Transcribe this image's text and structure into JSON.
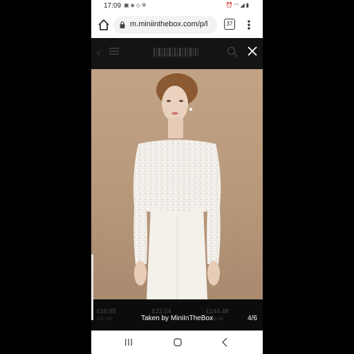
{
  "status_bar": {
    "time": "17:09",
    "left_icons": [
      "gallery-icon",
      "notification-icon",
      "location-icon",
      "settings-icon"
    ],
    "right_icons": [
      "alarm-icon",
      "wifi-icon",
      "signal-icon",
      "battery-icon"
    ]
  },
  "browser": {
    "url": "m.miniinthebox.com/p/l",
    "tab_count": "37"
  },
  "overlay": {
    "caption": "Taken by MiniInTheBox",
    "counter": "4/6",
    "logo_text": "MiniInTheBox.com"
  },
  "prices": [
    {
      "price": "£16.05",
      "old": "£32.06"
    },
    {
      "price": "£22.54",
      "old": "£45.08"
    },
    {
      "price": "£144.48",
      "old": "£288.96"
    }
  ],
  "colors": {
    "overlay_dark": "#141414",
    "photo_background": "#c2a385",
    "dress": "#f3efe9"
  }
}
